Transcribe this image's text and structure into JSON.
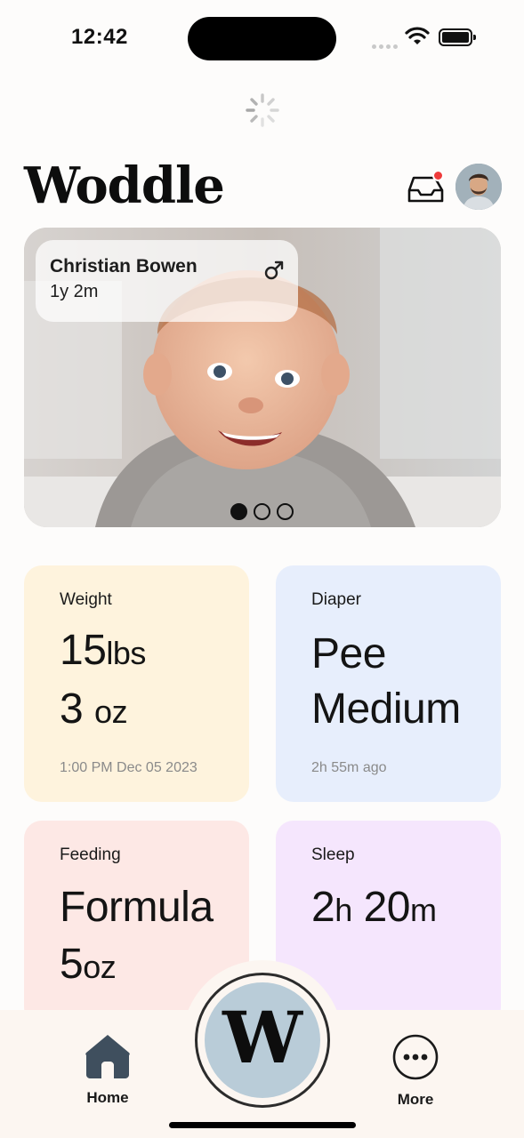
{
  "status_bar": {
    "time": "12:42"
  },
  "header": {
    "app_title": "Woddle"
  },
  "child": {
    "name": "Christian Bowen",
    "age": "1y 2m"
  },
  "carousel": {
    "total": 3,
    "active": 1
  },
  "cards": {
    "weight": {
      "label": "Weight",
      "line1_value": "15",
      "line1_unit": "lbs",
      "line2_value": "3",
      "line2_unit": "oz",
      "meta": "1:00 PM Dec 05 2023",
      "color": "#fef3dd"
    },
    "diaper": {
      "label": "Diaper",
      "line1": "Pee",
      "line2": "Medium",
      "meta": "2h 55m ago",
      "color": "#e7eefc"
    },
    "feeding": {
      "label": "Feeding",
      "line1": "Formula",
      "line2_value": "5",
      "line2_unit": "oz",
      "color": "#fde8e5"
    },
    "sleep": {
      "label": "Sleep",
      "hours": "2",
      "hours_unit": "h",
      "minutes": "20",
      "minutes_unit": "m",
      "color": "#f5e6fd"
    }
  },
  "tabbar": {
    "home_label": "Home",
    "center_letter": "W",
    "more_label": "More"
  },
  "icons": {
    "inbox": "inbox-icon",
    "notification": "notification-dot",
    "gender": "male-symbol-icon",
    "home": "home-icon",
    "more": "more-horizontal-icon"
  }
}
